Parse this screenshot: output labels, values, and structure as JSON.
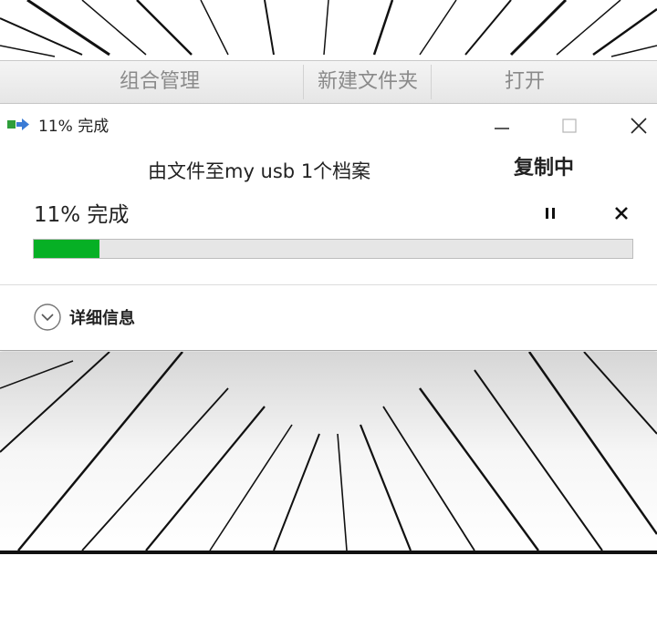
{
  "ribbon": {
    "items": [
      {
        "label": "组合管理"
      },
      {
        "label": "新建文件夹"
      },
      {
        "label": "打开"
      }
    ]
  },
  "dialog": {
    "title": "11% 完成",
    "source_line": "由文件至my usb 1个档案",
    "status": "复制中",
    "percent_line": "11% 完成",
    "progress": 0.11,
    "details_label": "详细信息"
  },
  "icons": {
    "app": "copy-transfer-icon",
    "minimize": "minimize-icon",
    "maximize": "maximize-icon",
    "close": "close-icon",
    "pause": "pause-icon",
    "cancel": "cancel-icon",
    "details": "chevron-down-circle-icon"
  },
  "colors": {
    "progress_fill": "#06b025",
    "progress_track": "#e6e6e6",
    "ribbon_text": "#8a8a8a"
  }
}
